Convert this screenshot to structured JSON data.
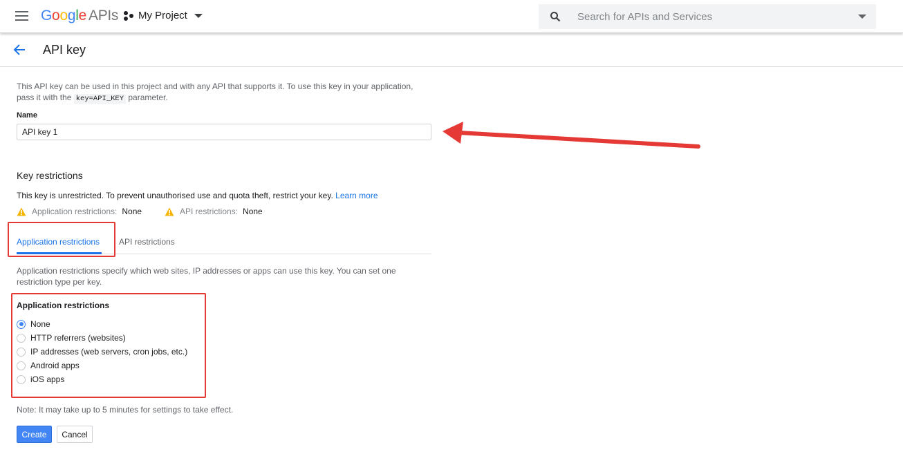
{
  "header": {
    "logo_google": "Google",
    "logo_apis": "APIs",
    "project": "My Project",
    "search_placeholder": "Search for APIs and Services"
  },
  "page": {
    "title": "API key",
    "description_before": "This API key can be used in this project and with any API that supports it. To use this key in your application, pass it with the ",
    "description_code": "key=API_KEY",
    "description_after": " parameter."
  },
  "name_field": {
    "label": "Name",
    "value": "API key 1"
  },
  "key_restrictions": {
    "heading": "Key restrictions",
    "text": "This key is unrestricted. To prevent unauthorised use and quota theft, restrict your key.",
    "learn_more": "Learn more",
    "app_restrictions_label": "Application restrictions:",
    "app_restrictions_value": "None",
    "api_restrictions_label": "API restrictions:",
    "api_restrictions_value": "None"
  },
  "tabs": [
    {
      "label": "Application restrictions",
      "active": true
    },
    {
      "label": "API restrictions",
      "active": false
    }
  ],
  "app_restrictions": {
    "description": "Application restrictions specify which web sites, IP addresses or apps can use this key. You can set one restriction type per key.",
    "heading": "Application restrictions",
    "options": [
      {
        "label": "None",
        "checked": true
      },
      {
        "label": "HTTP referrers (websites)",
        "checked": false
      },
      {
        "label": "IP addresses (web servers, cron jobs, etc.)",
        "checked": false
      },
      {
        "label": "Android apps",
        "checked": false
      },
      {
        "label": "iOS apps",
        "checked": false
      }
    ]
  },
  "note": "Note: It may take up to 5 minutes for settings to take effect.",
  "buttons": {
    "create": "Create",
    "cancel": "Cancel"
  },
  "colors": {
    "accent": "#1a73e8",
    "warning": "#f4b400",
    "annotation": "#e53935"
  },
  "icons": [
    "menu-icon",
    "search-icon",
    "project-icon",
    "back-arrow-icon",
    "warning-icon"
  ]
}
